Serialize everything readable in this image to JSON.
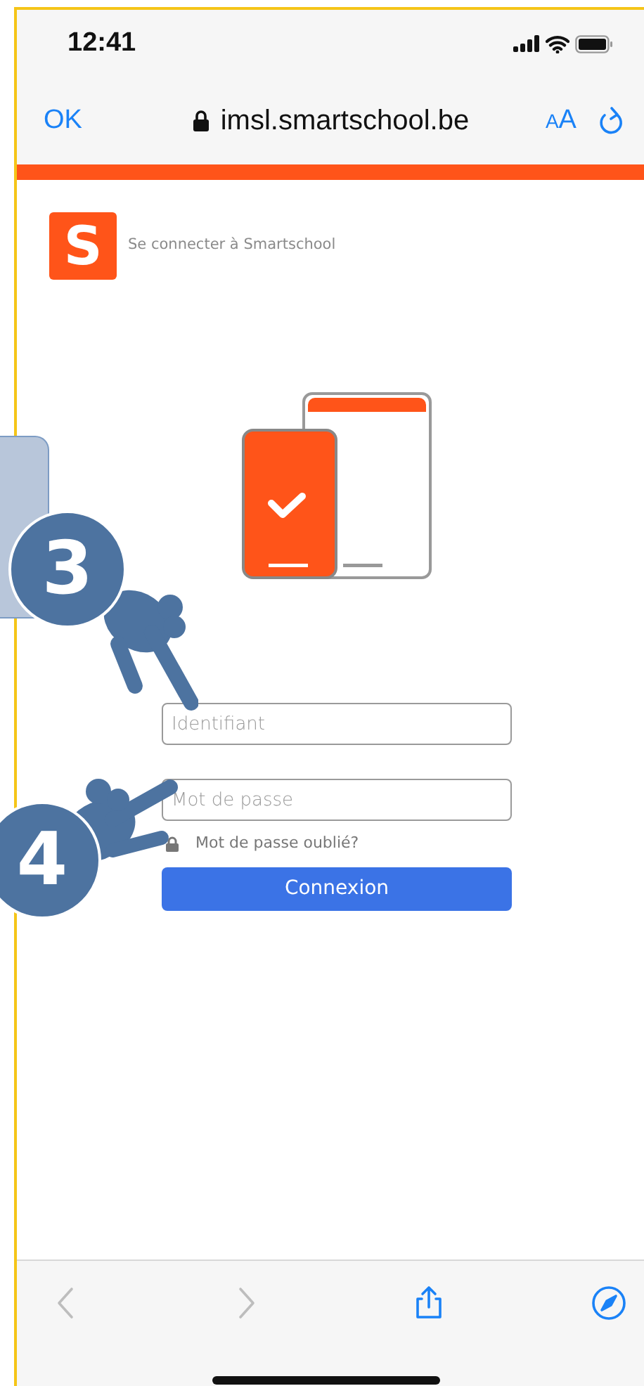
{
  "status_bar": {
    "time": "12:41"
  },
  "address_bar": {
    "done": "OK",
    "url": "imsl.smartschool.be",
    "text_size": "AA"
  },
  "page": {
    "logo": "S",
    "title": "Se connecter à Smartschool",
    "fields": [
      {
        "placeholder": "Identifiant"
      },
      {
        "placeholder": "Mot de passe"
      }
    ],
    "forgot_link": "Mot de passe oublié?",
    "submit": "Connexion"
  },
  "callouts": [
    {
      "number": "3"
    },
    {
      "number": "4"
    }
  ],
  "toolbar": [
    {
      "kind": "back",
      "disabled": true
    },
    {
      "kind": "forward",
      "disabled": true
    },
    {
      "kind": "share",
      "disabled": false
    },
    {
      "kind": "compass",
      "disabled": false
    }
  ]
}
